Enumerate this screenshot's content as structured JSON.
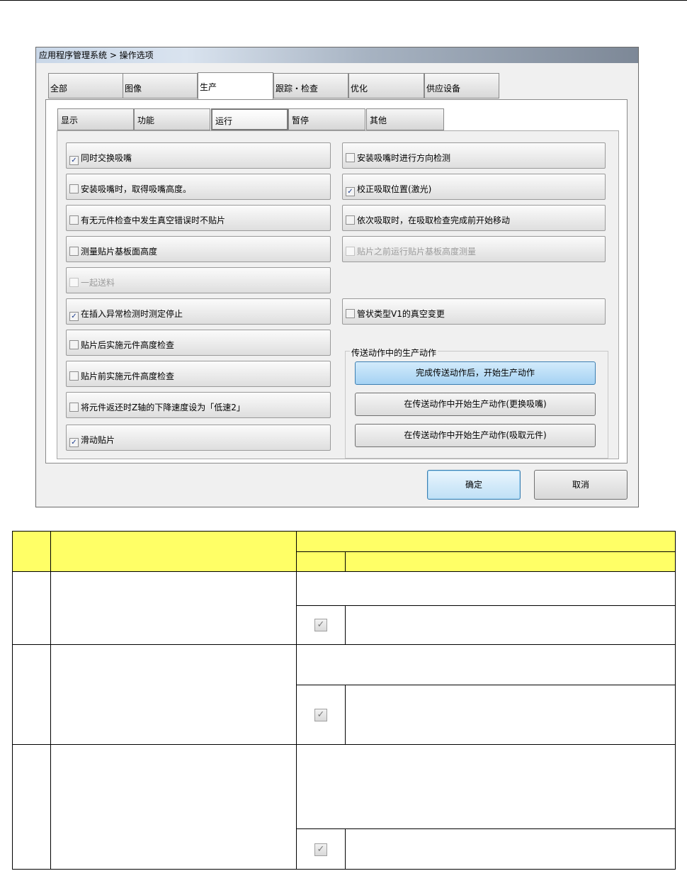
{
  "dialog": {
    "title": "应用程序管理系统 > 操作选项",
    "main_tabs": [
      {
        "label": "全部",
        "active": false
      },
      {
        "label": "图像",
        "active": false
      },
      {
        "label": "生产",
        "active": true
      },
      {
        "label": "跟踪・检查",
        "active": false
      },
      {
        "label": "优化",
        "active": false
      },
      {
        "label": "供应设备",
        "active": false
      }
    ],
    "sub_tabs": [
      {
        "label": "显示",
        "active": false
      },
      {
        "label": "功能",
        "active": false
      },
      {
        "label": "运行",
        "active": true
      },
      {
        "label": "暂停",
        "active": false
      },
      {
        "label": "其他",
        "active": false
      }
    ],
    "left_options": [
      {
        "label": "同时交换吸嘴",
        "checked": true,
        "enabled": true
      },
      {
        "label": "安装吸嘴时，取得吸嘴高度。",
        "checked": false,
        "enabled": true
      },
      {
        "label": "有无元件检查中发生真空错误时不贴片",
        "checked": false,
        "enabled": true
      },
      {
        "label": "测量贴片基板面高度",
        "checked": false,
        "enabled": true
      },
      {
        "label": "一起送料",
        "checked": false,
        "enabled": false
      },
      {
        "label": "在插入异常检测时测定停止",
        "checked": true,
        "enabled": true
      },
      {
        "label": "贴片后实施元件高度检查",
        "checked": false,
        "enabled": true
      },
      {
        "label": "贴片前实施元件高度检查",
        "checked": false,
        "enabled": true
      },
      {
        "label": "将元件返还时Z轴的下降速度设为「低速2」",
        "checked": false,
        "enabled": true
      },
      {
        "label": "滑动贴片",
        "checked": true,
        "enabled": true
      }
    ],
    "right_options": [
      {
        "label": "安装吸嘴时进行方向检测",
        "checked": false,
        "enabled": true
      },
      {
        "label": "校正吸取位置(激光)",
        "checked": true,
        "enabled": true
      },
      {
        "label": "依次吸取时，在吸取检查完成前开始移动",
        "checked": false,
        "enabled": true
      },
      {
        "label": "贴片之前运行贴片基板高度测量",
        "checked": false,
        "enabled": false
      },
      {
        "label": "管状类型V1的真空变更",
        "checked": false,
        "enabled": true
      }
    ],
    "group": {
      "label": "传送动作中的生产动作",
      "buttons": [
        {
          "label": "完成传送动作后，开始生产动作",
          "selected": true
        },
        {
          "label": "在传送动作中开始生产动作(更换吸嘴)",
          "selected": false
        },
        {
          "label": "在传送动作中开始生产动作(吸取元件)",
          "selected": false
        }
      ]
    },
    "ok_label": "确定",
    "cancel_label": "取消"
  },
  "checkmark_glyph": "✓",
  "colors": {
    "table_header": "#ffff66",
    "primary_button": "#a5d2f3"
  }
}
